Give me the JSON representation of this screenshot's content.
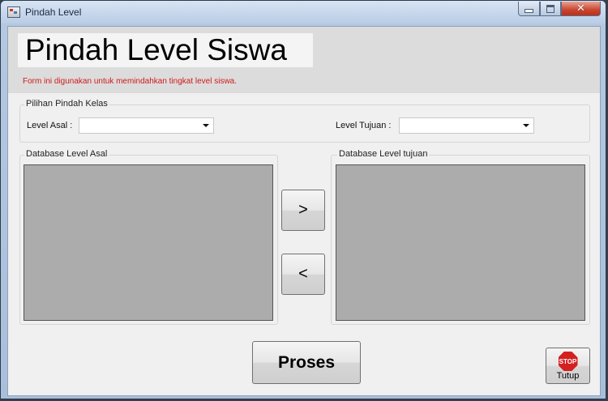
{
  "window": {
    "title": "Pindah Level"
  },
  "header": {
    "title": "Pindah Level Siswa",
    "subtitle": "Form ini digunakan untuk memindahkan tingkat level siswa."
  },
  "selection_group": {
    "label": "Pilihan Pindah Kelas",
    "from_label": "Level Asal :",
    "from_value": "",
    "to_label": "Level Tujuan :",
    "to_value": ""
  },
  "source_group": {
    "label": "Database Level Asal"
  },
  "target_group": {
    "label": "Database Level tujuan"
  },
  "buttons": {
    "move_right": ">",
    "move_left": "<",
    "process": "Proses",
    "close": "Tutup",
    "stop_icon_text": "STOP"
  },
  "icons": [
    "app-icon",
    "minimize-icon",
    "maximize-icon",
    "close-icon",
    "stop-sign-icon"
  ]
}
